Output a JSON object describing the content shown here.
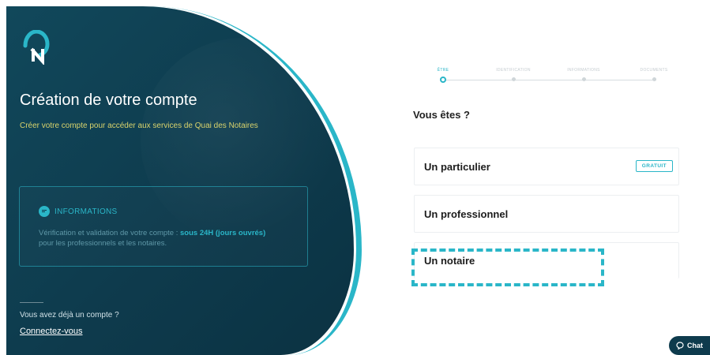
{
  "hero": {
    "title": "Création de votre compte",
    "subtitle": "Créer votre compte pour accéder aux services de Quai des Notaires",
    "info_heading": "INFORMATIONS",
    "info_text_before": "Vérification et validation de votre compte : ",
    "info_text_highlight": "sous 24H (jours ouvrés)",
    "info_text_after": "pour les professionnels et les notaires.",
    "account_question": "Vous avez déjà un compte ?",
    "login_link": "Connectez-vous"
  },
  "stepper": {
    "steps": [
      {
        "label": "ÊTRE",
        "active": true
      },
      {
        "label": "IDENTIFICATION",
        "active": false
      },
      {
        "label": "INFORMATIONS",
        "active": false
      },
      {
        "label": "DOCUMENTS",
        "active": false
      }
    ]
  },
  "form": {
    "question": "Vous êtes ?",
    "options": [
      {
        "label": "Un particulier",
        "badge": "GRATUIT"
      },
      {
        "label": "Un professionnel"
      },
      {
        "label": "Un notaire"
      }
    ]
  },
  "chat": {
    "label": "Chat"
  },
  "colors": {
    "brand_dark": "#0e3b4d",
    "accent": "#2ab6c8",
    "subtitle_yellow": "#d9d36c"
  }
}
